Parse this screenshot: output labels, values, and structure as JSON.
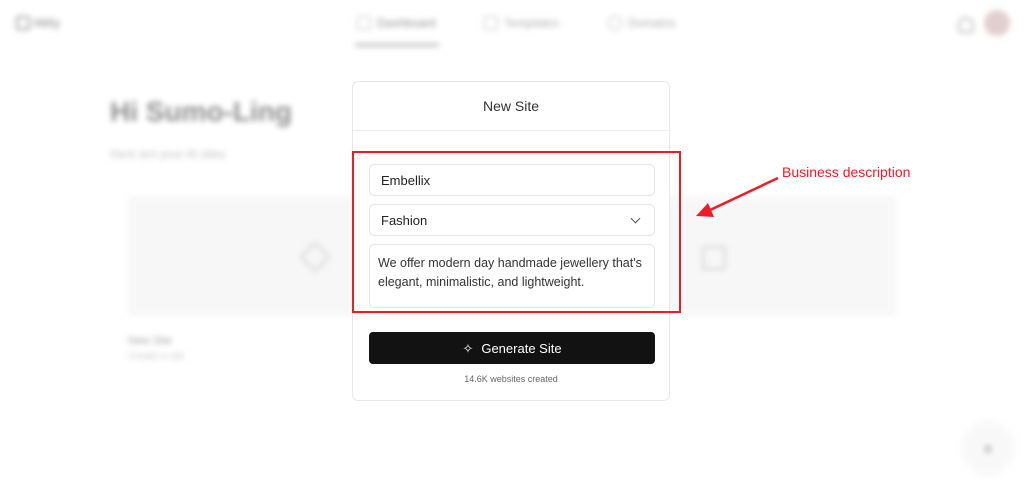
{
  "background": {
    "logo_text": "Hitly",
    "nav": [
      {
        "label": "Dashboard"
      },
      {
        "label": "Templates"
      },
      {
        "label": "Domains"
      }
    ],
    "greeting": "Hi Sumo-Ling",
    "subtext": "Here are your AI sites",
    "card_title": "New Site",
    "card_subtitle": "Create a site"
  },
  "modal": {
    "title": "New Site",
    "business_name_value": "Embellix",
    "industry_value": "Fashion",
    "description_value": "We offer modern day handmade jewellery that's elegant, minimalistic, and lightweight.",
    "generate_button_label": "Generate Site",
    "websites_created": "14.6K websites created"
  },
  "annotation": {
    "label": "Business description",
    "color": "#ee1c24"
  },
  "icons": {
    "generate": "sparkle-icon",
    "select": "chevron-down-icon"
  }
}
